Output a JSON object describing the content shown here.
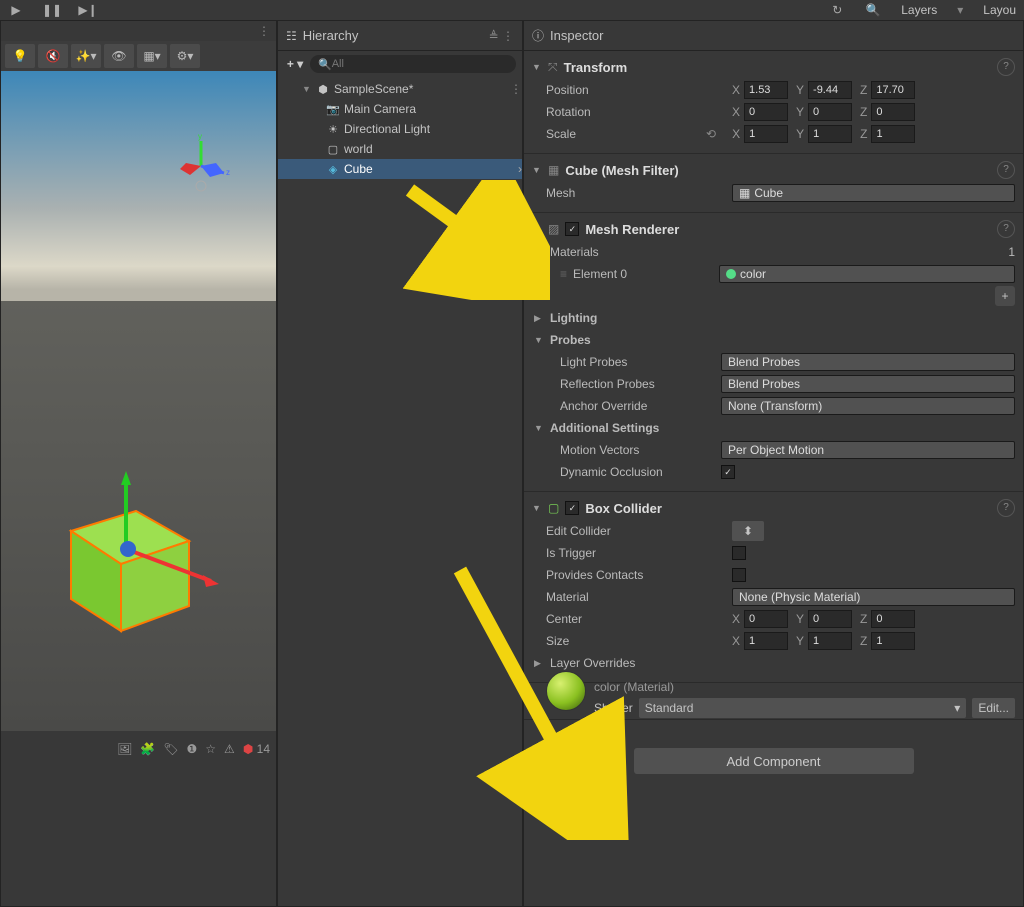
{
  "topmenu": {
    "layers": "Layers",
    "layout": "Layou"
  },
  "hierarchy": {
    "title": "Hierarchy",
    "search_placeholder": "All",
    "scene": "SampleScene*",
    "items": [
      "Main Camera",
      "Directional Light",
      "world",
      "Cube"
    ]
  },
  "inspector": {
    "title": "Inspector",
    "transform": {
      "name": "Transform",
      "position": {
        "label": "Position",
        "x": "1.53",
        "y": "-9.44",
        "z": "17.70"
      },
      "rotation": {
        "label": "Rotation",
        "x": "0",
        "y": "0",
        "z": "0"
      },
      "scale": {
        "label": "Scale",
        "x": "1",
        "y": "1",
        "z": "1"
      }
    },
    "meshfilter": {
      "name": "Cube (Mesh Filter)",
      "mesh_label": "Mesh",
      "mesh_value": "Cube"
    },
    "meshrenderer": {
      "name": "Mesh Renderer",
      "materials": "Materials",
      "materials_count": "1",
      "element0_label": "Element 0",
      "element0_value": "color",
      "lighting": "Lighting",
      "probes": "Probes",
      "light_probes_label": "Light Probes",
      "light_probes_value": "Blend Probes",
      "reflection_probes_label": "Reflection Probes",
      "reflection_probes_value": "Blend Probes",
      "anchor_override_label": "Anchor Override",
      "anchor_override_value": "None (Transform)",
      "additional": "Additional Settings",
      "motion_vectors_label": "Motion Vectors",
      "motion_vectors_value": "Per Object Motion",
      "dynamic_occlusion_label": "Dynamic Occlusion"
    },
    "boxcollider": {
      "name": "Box Collider",
      "edit_collider": "Edit Collider",
      "is_trigger": "Is Trigger",
      "provides_contacts": "Provides Contacts",
      "material_label": "Material",
      "material_value": "None (Physic Material)",
      "center": {
        "label": "Center",
        "x": "0",
        "y": "0",
        "z": "0"
      },
      "size": {
        "label": "Size",
        "x": "1",
        "y": "1",
        "z": "1"
      },
      "layer_overrides": "Layer Overrides"
    },
    "material": {
      "name": "color (Material)",
      "shader_label": "Shader",
      "shader_value": "Standard",
      "edit": "Edit..."
    },
    "add_component": "Add Component"
  },
  "console": {
    "error_count": "14"
  }
}
